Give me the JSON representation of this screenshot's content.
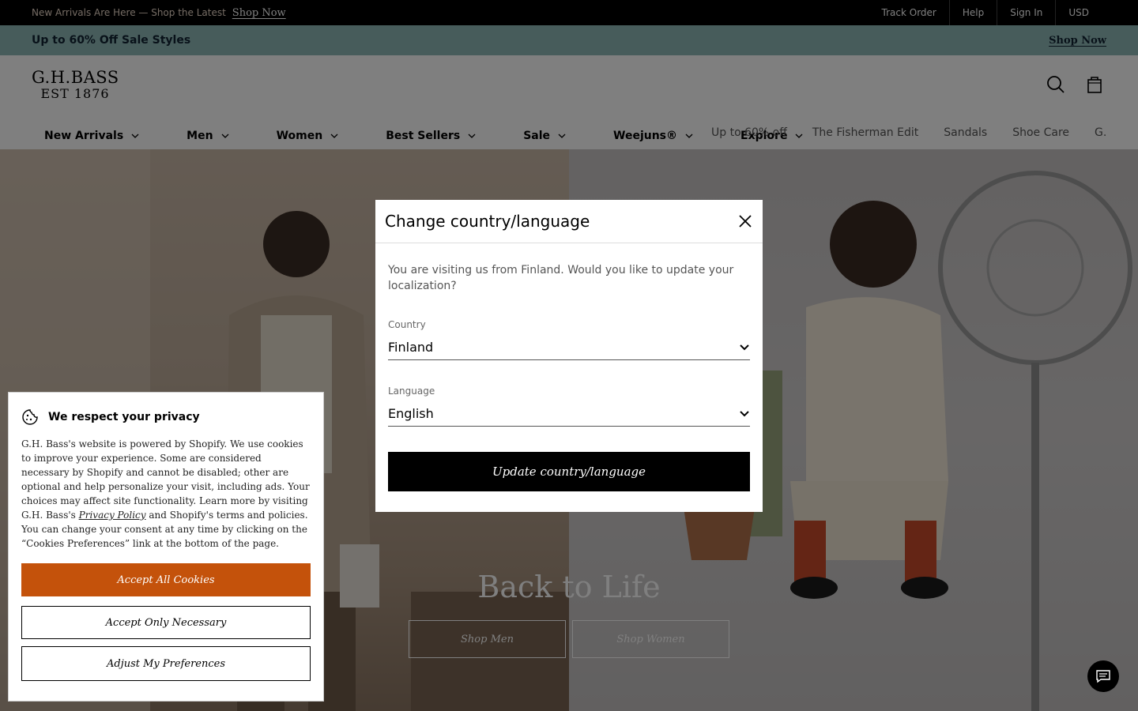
{
  "announcement": {
    "promo_text": "New Arrivals Are Here — Shop the Latest",
    "promo_link": "Shop Now",
    "utils": [
      "Track Order",
      "Help",
      "Sign In",
      "USD"
    ]
  },
  "sale_bar": {
    "text": "Up to 60% Off Sale Styles",
    "link": "Shop Now"
  },
  "header": {
    "logo_line1": "G.H.BASS",
    "logo_line2": "EST 1876",
    "main_nav": [
      "New Arrivals",
      "Men",
      "Women",
      "Best Sellers",
      "Sale",
      "Weejuns®",
      "Explore"
    ],
    "sub_nav": [
      "Up to 60% off",
      "The Fisherman Edit",
      "Sandals",
      "Shoe Care",
      "G.H.B"
    ]
  },
  "hero": {
    "title": "Back to Life",
    "buttons": [
      "Shop Men",
      "Shop Women"
    ]
  },
  "modal": {
    "title": "Change country/language",
    "message": "You are visiting us from Finland. Would you like to update your localization?",
    "country_label": "Country",
    "country_value": "Finland",
    "language_label": "Language",
    "language_value": "English",
    "submit": "Update country/language"
  },
  "cookie": {
    "title": "We respect your privacy",
    "text_before": "G.H. Bass's website is powered by Shopify. We use cookies to improve your experience. Some are considered necessary by Shopify and cannot be disabled; other are optional and help personalize your visit, including ads. Your choices may affect site functionality. Learn more by visiting G.H. Bass's ",
    "privacy_link": "Privacy Policy",
    "text_after": " and Shopify's terms and policies. You can change your consent at any time by clicking on the “Cookies Preferences” link at the bottom of the page.",
    "accept_all": "Accept All Cookies",
    "accept_necessary": "Accept Only Necessary",
    "adjust": "Adjust My Preferences",
    "accent_color": "#c4520b"
  },
  "colors": {
    "sale_bar_bg": "#8fb9b6",
    "top_bar_bg": "#000000"
  }
}
